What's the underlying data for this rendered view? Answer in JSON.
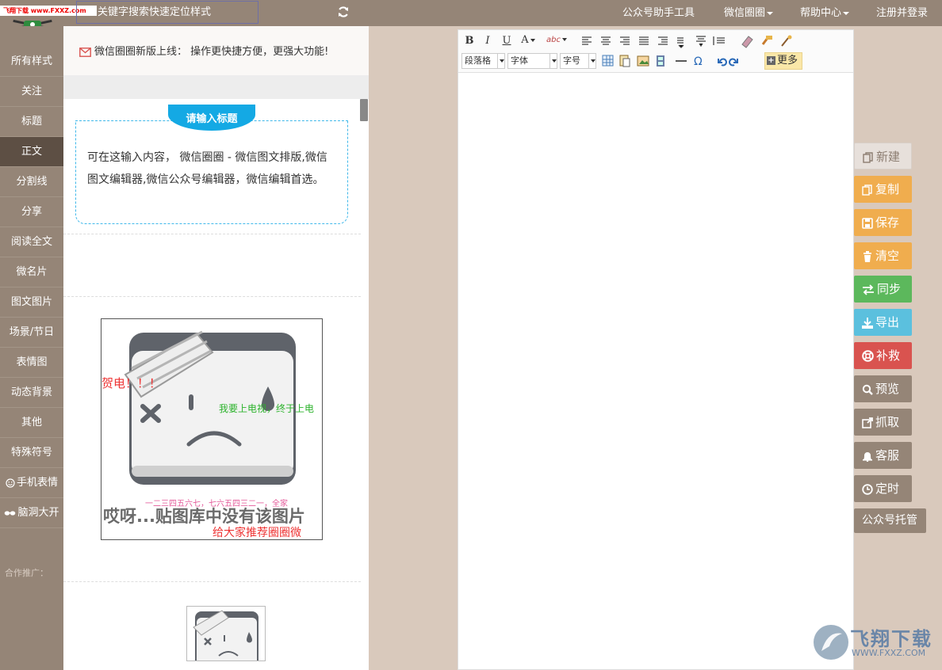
{
  "watermark_top": "飞翔下载 www.FXXZ.com",
  "search": {
    "text": "关键字搜索快速定位样式"
  },
  "topnav": [
    {
      "label": "公众号助手工具",
      "dropdown": false
    },
    {
      "label": "微信圈圈",
      "dropdown": true
    },
    {
      "label": "帮助中心",
      "dropdown": true
    },
    {
      "label": "注册并登录",
      "dropdown": false
    }
  ],
  "sidebar": {
    "items": [
      {
        "label": "所有样式",
        "icon": ""
      },
      {
        "label": "关注",
        "icon": ""
      },
      {
        "label": "标题",
        "icon": ""
      },
      {
        "label": "正文",
        "icon": "",
        "active": true
      },
      {
        "label": "分割线",
        "icon": ""
      },
      {
        "label": "分享",
        "icon": ""
      },
      {
        "label": "阅读全文",
        "icon": ""
      },
      {
        "label": "微名片",
        "icon": ""
      },
      {
        "label": "图文图片",
        "icon": ""
      },
      {
        "label": "场景/节日",
        "icon": ""
      },
      {
        "label": "表情图",
        "icon": ""
      },
      {
        "label": "动态背景",
        "icon": ""
      },
      {
        "label": "其他",
        "icon": ""
      },
      {
        "label": "特殊符号",
        "icon": ""
      },
      {
        "label": "手机表情",
        "icon": "smile-icon"
      },
      {
        "label": "脑洞大开",
        "icon": "glasses-icon"
      }
    ],
    "partner": "合作推广："
  },
  "notice": "微信圈圈新版上线： 操作更快捷方便，更强大功能!",
  "template": {
    "title": "请输入标题",
    "body": "可在这输入内容， 微信圈圈 - 微信图文排版,微信图文编辑器,微信公众号编辑器，微信编辑首选。"
  },
  "image_card": {
    "caption": "哎呀...贴图库中没有该图片",
    "overlay_red": "贺电！！！",
    "overlay_green": "我要上电视，终于上电",
    "overlay_pink": "一二三四五六七，七六五四三二一，全家",
    "overlay_red2": "给大家推荐圈圈微"
  },
  "toolbar": {
    "row1": [
      "B",
      "I",
      "U",
      "A",
      "abc"
    ],
    "paragraph": "段落格",
    "font": "字体",
    "size": "字号",
    "more": "更多"
  },
  "actions": [
    {
      "label": "新建",
      "color": "#e7e0db",
      "text": "#8c7d71",
      "icon": "copy-icon"
    },
    {
      "label": "复制",
      "color": "#f0ad4e",
      "text": "#ffffff",
      "icon": "copy-icon"
    },
    {
      "label": "保存",
      "color": "#f0ad4e",
      "text": "#ffffff",
      "icon": "save-icon"
    },
    {
      "label": "清空",
      "color": "#f0ad4e",
      "text": "#ffffff",
      "icon": "trash-icon"
    },
    {
      "label": "同步",
      "color": "#5cb85c",
      "text": "#ffffff",
      "icon": "exchange-icon"
    },
    {
      "label": "导出",
      "color": "#5bc0de",
      "text": "#ffffff",
      "icon": "download-icon"
    },
    {
      "label": "补救",
      "color": "#d9534f",
      "text": "#ffffff",
      "icon": "lifebuoy-icon"
    },
    {
      "label": "预览",
      "color": "#958577",
      "text": "#ffffff",
      "icon": "search-icon"
    },
    {
      "label": "抓取",
      "color": "#958577",
      "text": "#ffffff",
      "icon": "external-link-icon"
    },
    {
      "label": "客服",
      "color": "#958577",
      "text": "#ffffff",
      "icon": "bell-icon"
    },
    {
      "label": "定时",
      "color": "#958577",
      "text": "#ffffff",
      "icon": "clock-icon"
    },
    {
      "label": "公众号托管",
      "color": "#958577",
      "text": "#ffffff",
      "icon": ""
    }
  ],
  "watermark": {
    "big": "飞翔下载",
    "small": "WWW.FXXZ.COM"
  },
  "colors": {
    "brand": "#958577",
    "active_nav": "#5d4f44",
    "accent_blue": "#14a9e4",
    "workspace": "#d9c9bc"
  }
}
